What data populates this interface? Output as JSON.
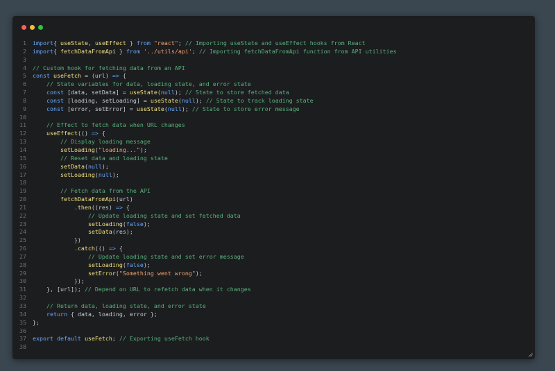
{
  "window": {
    "controls": [
      {
        "name": "close",
        "color": "#ff5f56"
      },
      {
        "name": "minimize",
        "color": "#ffbd2e"
      },
      {
        "name": "maximize",
        "color": "#27c93f"
      }
    ]
  },
  "colors": {
    "background": "#3a4650",
    "editor_bg": "#1c1d1f",
    "keyword": "#66a8ff",
    "string": "#f2a46e",
    "comment": "#58b07c",
    "text": "#c5cbd3",
    "line_number": "#6b7178"
  },
  "code": {
    "lines": [
      {
        "n": "1",
        "tokens": [
          [
            "kw",
            "import"
          ],
          [
            "",
            "{ "
          ],
          [
            "fn",
            "useState"
          ],
          [
            "",
            ", "
          ],
          [
            "fn",
            "useEffect"
          ],
          [
            "",
            " } "
          ],
          [
            "kw",
            "from"
          ],
          [
            "",
            ""
          ],
          [
            "str",
            " \"react\""
          ],
          [
            "",
            "; "
          ],
          [
            "cm",
            "// Importing useState and useEffect hooks from React"
          ]
        ]
      },
      {
        "n": "2",
        "tokens": [
          [
            "kw",
            "import"
          ],
          [
            "",
            "{ "
          ],
          [
            "fn",
            "fetchDataFromApi"
          ],
          [
            "",
            " } "
          ],
          [
            "kw",
            "from"
          ],
          [
            "str",
            " '../utils/api'"
          ],
          [
            "",
            "; "
          ],
          [
            "cm",
            "// Importing fetchDataFromApi function from API utilities"
          ]
        ]
      },
      {
        "n": "3",
        "tokens": []
      },
      {
        "n": "4",
        "tokens": [
          [
            "cm",
            "// Custom hook for fetching data from an API"
          ]
        ]
      },
      {
        "n": "5",
        "tokens": [
          [
            "kw",
            "const "
          ],
          [
            "fn",
            "useFetch"
          ],
          [
            "",
            " = (url) "
          ],
          [
            "kw",
            "=>"
          ],
          [
            "",
            " {"
          ]
        ]
      },
      {
        "n": "6",
        "tokens": [
          [
            "",
            "    "
          ],
          [
            "cm",
            "// State variables for data, loading state, and error state"
          ]
        ]
      },
      {
        "n": "7",
        "tokens": [
          [
            "",
            "    "
          ],
          [
            "kw",
            "const "
          ],
          [
            "",
            "[data, setData] = "
          ],
          [
            "fn",
            "useState"
          ],
          [
            "",
            "("
          ],
          [
            "kw",
            "null"
          ],
          [
            "",
            "); "
          ],
          [
            "cm",
            "// State to store fetched data"
          ]
        ]
      },
      {
        "n": "8",
        "tokens": [
          [
            "",
            "    "
          ],
          [
            "kw",
            "const "
          ],
          [
            "",
            "[loading, setLoading] = "
          ],
          [
            "fn",
            "useState"
          ],
          [
            "",
            "("
          ],
          [
            "kw",
            "null"
          ],
          [
            "",
            "); "
          ],
          [
            "cm",
            "// State to track loading state"
          ]
        ]
      },
      {
        "n": "9",
        "tokens": [
          [
            "",
            "    "
          ],
          [
            "kw",
            "const "
          ],
          [
            "",
            "[error, setError] = "
          ],
          [
            "fn",
            "useState"
          ],
          [
            "",
            "("
          ],
          [
            "kw",
            "null"
          ],
          [
            "",
            "); "
          ],
          [
            "cm",
            "// State to store error message"
          ]
        ]
      },
      {
        "n": "10",
        "tokens": []
      },
      {
        "n": "11",
        "tokens": [
          [
            "",
            "    "
          ],
          [
            "cm",
            "// Effect to fetch data when URL changes"
          ]
        ]
      },
      {
        "n": "12",
        "tokens": [
          [
            "",
            "    "
          ],
          [
            "fn",
            "useEffect"
          ],
          [
            "",
            "(() "
          ],
          [
            "kw",
            "=>"
          ],
          [
            "",
            " {"
          ]
        ]
      },
      {
        "n": "13",
        "tokens": [
          [
            "",
            "        "
          ],
          [
            "cm",
            "// Display loading message"
          ]
        ]
      },
      {
        "n": "14",
        "tokens": [
          [
            "",
            "        "
          ],
          [
            "fn",
            "setLoading"
          ],
          [
            "",
            "("
          ],
          [
            "str",
            "\"loading...\""
          ],
          [
            "",
            ");"
          ]
        ]
      },
      {
        "n": "15",
        "tokens": [
          [
            "",
            "        "
          ],
          [
            "cm",
            "// Reset data and loading state"
          ]
        ]
      },
      {
        "n": "16",
        "tokens": [
          [
            "",
            "        "
          ],
          [
            "fn",
            "setData"
          ],
          [
            "",
            "("
          ],
          [
            "kw",
            "null"
          ],
          [
            "",
            ");"
          ]
        ]
      },
      {
        "n": "17",
        "tokens": [
          [
            "",
            "        "
          ],
          [
            "fn",
            "setLoading"
          ],
          [
            "",
            "("
          ],
          [
            "kw",
            "null"
          ],
          [
            "",
            ");"
          ]
        ]
      },
      {
        "n": "18",
        "tokens": []
      },
      {
        "n": "19",
        "tokens": [
          [
            "",
            "        "
          ],
          [
            "cm",
            "// Fetch data from the API"
          ]
        ]
      },
      {
        "n": "20",
        "tokens": [
          [
            "",
            "        "
          ],
          [
            "fn",
            "fetchDataFromApi"
          ],
          [
            "",
            "(url)"
          ]
        ]
      },
      {
        "n": "21",
        "tokens": [
          [
            "",
            "            ."
          ],
          [
            "fn",
            "then"
          ],
          [
            "",
            "((res) "
          ],
          [
            "kw",
            "=>"
          ],
          [
            "",
            " {"
          ]
        ]
      },
      {
        "n": "22",
        "tokens": [
          [
            "",
            "                "
          ],
          [
            "cm",
            "// Update loading state and set fetched data"
          ]
        ]
      },
      {
        "n": "23",
        "tokens": [
          [
            "",
            "                "
          ],
          [
            "fn",
            "setLoading"
          ],
          [
            "",
            "("
          ],
          [
            "kw",
            "false"
          ],
          [
            "",
            ");"
          ]
        ]
      },
      {
        "n": "24",
        "tokens": [
          [
            "",
            "                "
          ],
          [
            "fn",
            "setData"
          ],
          [
            "",
            "(res);"
          ]
        ]
      },
      {
        "n": "25",
        "tokens": [
          [
            "",
            "            })"
          ]
        ]
      },
      {
        "n": "26",
        "tokens": [
          [
            "",
            "            ."
          ],
          [
            "fn",
            "catch"
          ],
          [
            "",
            "(() "
          ],
          [
            "kw",
            "=>"
          ],
          [
            "",
            " {"
          ]
        ]
      },
      {
        "n": "27",
        "tokens": [
          [
            "",
            "                "
          ],
          [
            "cm",
            "// Update loading state and set error message"
          ]
        ]
      },
      {
        "n": "28",
        "tokens": [
          [
            "",
            "                "
          ],
          [
            "fn",
            "setLoading"
          ],
          [
            "",
            "("
          ],
          [
            "kw",
            "false"
          ],
          [
            "",
            ");"
          ]
        ]
      },
      {
        "n": "29",
        "tokens": [
          [
            "",
            "                "
          ],
          [
            "fn",
            "setError"
          ],
          [
            "",
            "("
          ],
          [
            "str",
            "\"Something went wrong\""
          ],
          [
            "",
            ");"
          ]
        ]
      },
      {
        "n": "30",
        "tokens": [
          [
            "",
            "            });"
          ]
        ]
      },
      {
        "n": "31",
        "tokens": [
          [
            "",
            "    }, [url]); "
          ],
          [
            "cm",
            "// Depend on URL to refetch data when it changes"
          ]
        ]
      },
      {
        "n": "32",
        "tokens": []
      },
      {
        "n": "33",
        "tokens": [
          [
            "",
            "    "
          ],
          [
            "cm",
            "// Return data, loading state, and error state"
          ]
        ]
      },
      {
        "n": "34",
        "tokens": [
          [
            "",
            "    "
          ],
          [
            "kw",
            "return"
          ],
          [
            "",
            " { data, loading, error };"
          ]
        ]
      },
      {
        "n": "35",
        "tokens": [
          [
            "",
            "};"
          ]
        ]
      },
      {
        "n": "36",
        "tokens": []
      },
      {
        "n": "37",
        "tokens": [
          [
            "kw",
            "export default "
          ],
          [
            "fn",
            "useFetch"
          ],
          [
            "",
            "; "
          ],
          [
            "cm",
            "// Exporting useFetch hook"
          ]
        ]
      },
      {
        "n": "38",
        "tokens": []
      }
    ]
  }
}
